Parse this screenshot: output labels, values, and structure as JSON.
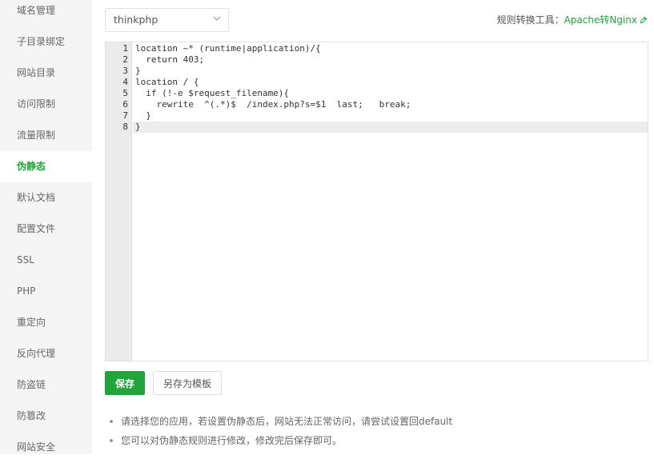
{
  "sidebar": {
    "items": [
      {
        "label": "域名管理"
      },
      {
        "label": "子目录绑定"
      },
      {
        "label": "网站目录"
      },
      {
        "label": "访问限制"
      },
      {
        "label": "流量限制"
      },
      {
        "label": "伪静态",
        "active": true
      },
      {
        "label": "默认文档"
      },
      {
        "label": "配置文件"
      },
      {
        "label": "SSL"
      },
      {
        "label": "PHP"
      },
      {
        "label": "重定向"
      },
      {
        "label": "反向代理"
      },
      {
        "label": "防盗链"
      },
      {
        "label": "防篡改"
      },
      {
        "label": "网站安全"
      }
    ]
  },
  "template_select": {
    "value": "thinkphp"
  },
  "converter": {
    "prefix": "规则转换工具：",
    "link": "Apache转Nginx",
    "icon": "link-icon"
  },
  "editor": {
    "line_numbers": [
      "1",
      "2",
      "3",
      "4",
      "5",
      "6",
      "7",
      "8"
    ],
    "lines": [
      "location ~* (runtime|application)/{",
      "  return 403;",
      "}",
      "location / {",
      "  if (!-e $request_filename){",
      "    rewrite  ^(.*)$  /index.php?s=$1  last;   break;",
      "  }",
      "}"
    ],
    "current_line": 8
  },
  "buttons": {
    "save": "保存",
    "save_as_template": "另存为模板"
  },
  "tips": [
    "请选择您的应用，若设置伪静态后，网站无法正常访问，请尝试设置回default",
    "您可以对伪静态规则进行修改，修改完后保存即可。"
  ],
  "colors": {
    "accent": "#20a53a",
    "sidebar_bg": "#f5f5f5",
    "gutter_bg": "#ebebeb"
  }
}
